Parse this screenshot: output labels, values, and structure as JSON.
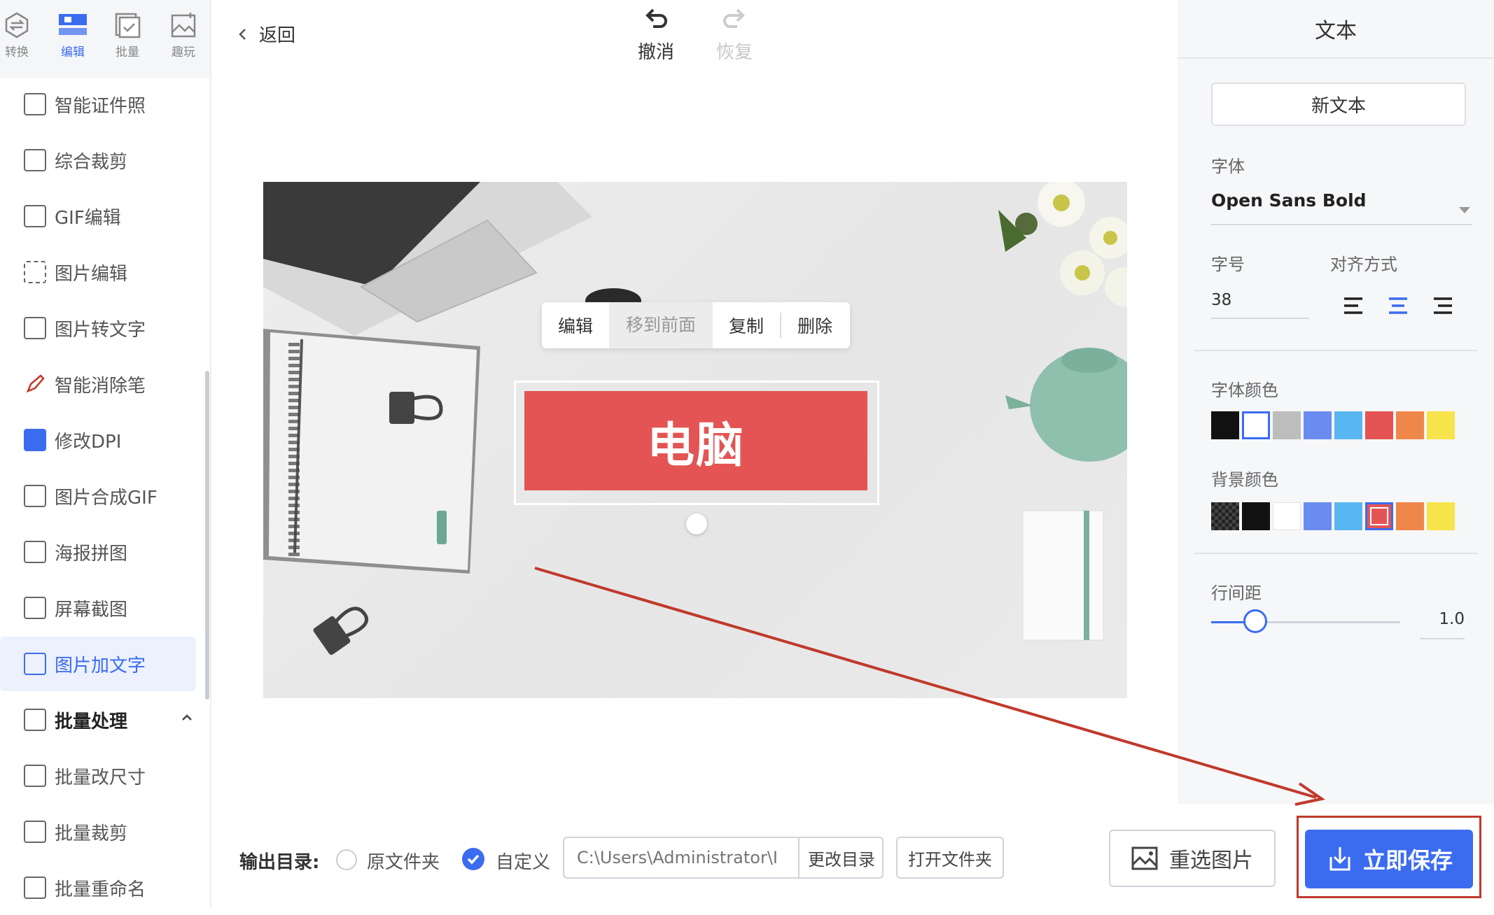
{
  "nav_tabs": [
    {
      "label": "转换",
      "icon": "convert-icon"
    },
    {
      "label": "编辑",
      "icon": "edit-icon"
    },
    {
      "label": "批量",
      "icon": "batch-icon"
    },
    {
      "label": "趣玩",
      "icon": "fun-icon"
    }
  ],
  "sidebar": {
    "items": [
      {
        "label": "智能证件照",
        "icon": "id-photo-icon"
      },
      {
        "label": "综合裁剪",
        "icon": "crop-icon"
      },
      {
        "label": "GIF编辑",
        "icon": "gif-edit-icon"
      },
      {
        "label": "图片编辑",
        "icon": "image-edit-icon"
      },
      {
        "label": "图片转文字",
        "icon": "ocr-icon"
      },
      {
        "label": "智能消除笔",
        "icon": "eraser-pen-icon"
      },
      {
        "label": "修改DPI",
        "icon": "dpi-icon"
      },
      {
        "label": "图片合成GIF",
        "icon": "gif-compose-icon"
      },
      {
        "label": "海报拼图",
        "icon": "poster-collage-icon"
      },
      {
        "label": "屏幕截图",
        "icon": "screenshot-icon"
      },
      {
        "label": "图片加文字",
        "icon": "add-text-icon"
      }
    ],
    "group": {
      "label": "批量处理",
      "icon": "batch-process-icon",
      "toggle": "chevron-up-icon"
    },
    "group_items": [
      {
        "label": "批量改尺寸",
        "icon": "batch-resize-icon"
      },
      {
        "label": "批量裁剪",
        "icon": "batch-crop-icon"
      },
      {
        "label": "批量重命名",
        "icon": "batch-rename-icon"
      }
    ]
  },
  "header": {
    "back_label": "返回",
    "undo_label": "撤消",
    "redo_label": "恢复"
  },
  "context_menu": [
    "编辑",
    "移到前面",
    "复制",
    "删除"
  ],
  "text_box": {
    "text": "电脑",
    "bg_color": "#e45454",
    "text_color": "#ffffff"
  },
  "panel": {
    "title": "文本",
    "new_text_label": "新文本",
    "font_label": "字体",
    "font_value": "Open Sans Bold",
    "size_label": "字号",
    "size_value": "38",
    "align_label": "对齐方式",
    "align_selected": "center",
    "font_color_label": "字体颜色",
    "font_colors": [
      "#111111",
      "#ffffff",
      "#bdbdbd",
      "#6a8cf0",
      "#58b7f0",
      "#e45454",
      "#f0874a",
      "#f7e34a"
    ],
    "font_color_selected": 1,
    "bg_color_label": "背景颜色",
    "bg_colors": [
      "transparent",
      "#111111",
      "#ffffff",
      "#6a8cf0",
      "#58b7f0",
      "#e45454",
      "#f0874a",
      "#f7e34a"
    ],
    "bg_color_selected": 5,
    "line_spacing_label": "行间距",
    "line_spacing_value": "1.0"
  },
  "bottom": {
    "output_label": "输出目录:",
    "option_original": "原文件夹",
    "option_custom": "自定义",
    "selected": "custom",
    "path_placeholder": "C:\\Users\\Administrator\\I",
    "change_dir_label": "更改目录",
    "open_folder_label": "打开文件夹",
    "reselect_label": "重选图片",
    "save_label": "立即保存"
  },
  "colors": {
    "accent": "#3b6cf0",
    "annotation": "#c0392b"
  }
}
